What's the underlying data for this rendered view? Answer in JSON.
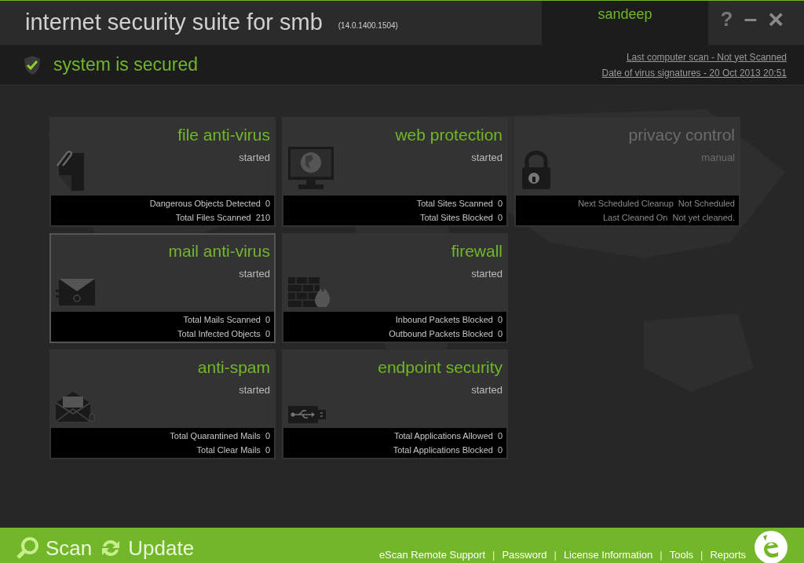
{
  "window": {
    "title": "internet security suite for smb",
    "version": "(14.0.1400.1504)",
    "user": "sandeep",
    "controls": [
      {
        "kind": "help",
        "label": "?"
      },
      {
        "kind": "minimize",
        "label": "–"
      },
      {
        "kind": "close",
        "label": "×"
      }
    ]
  },
  "status": {
    "secured": true,
    "text": "system is secured",
    "links": [
      "Last computer scan - Not yet Scanned",
      "Date of  virus signatures - 20 Oct 2013 20:51"
    ]
  },
  "tile_rows": [
    [
      {
        "kind": "file",
        "title": "file anti-virus",
        "state": "started",
        "enabled": true,
        "selected": false,
        "stats": [
          {
            "label": "Dangerous Objects Detected",
            "value": "0"
          },
          {
            "label": "Total Files Scanned",
            "value": "210"
          }
        ]
      },
      {
        "kind": "web",
        "title": "web protection",
        "state": "started",
        "enabled": true,
        "selected": false,
        "stats": [
          {
            "label": "Total Sites Scanned",
            "value": "0"
          },
          {
            "label": "Total Sites Blocked",
            "value": "0"
          }
        ]
      },
      {
        "kind": "privacy",
        "title": "privacy control",
        "state": "manual",
        "enabled": false,
        "selected": false,
        "stats": [
          {
            "label": "Next Scheduled Cleanup",
            "value": "Not Scheduled"
          },
          {
            "label": "Last Cleaned On",
            "value": "Not yet cleaned."
          }
        ]
      }
    ],
    [
      {
        "kind": "mail",
        "title": "mail anti-virus",
        "state": "started",
        "enabled": true,
        "selected": true,
        "stats": [
          {
            "label": "Total Mails Scanned",
            "value": "0"
          },
          {
            "label": "Total Infected Objects",
            "value": "0"
          }
        ]
      },
      {
        "kind": "firewall",
        "title": "firewall",
        "state": "started",
        "enabled": true,
        "selected": false,
        "stats": [
          {
            "label": "Inbound Packets Blocked",
            "value": "0"
          },
          {
            "label": "Outbound Packets Blocked",
            "value": "0"
          }
        ]
      }
    ],
    [
      {
        "kind": "spam",
        "title": "anti-spam",
        "state": "started",
        "enabled": true,
        "selected": false,
        "stats": [
          {
            "label": "Total Quarantined Mails",
            "value": "0"
          },
          {
            "label": "Total Clear Mails",
            "value": "0"
          }
        ]
      },
      {
        "kind": "endpoint",
        "title": "endpoint security",
        "state": "started",
        "enabled": true,
        "selected": false,
        "stats": [
          {
            "label": "Total Applications Allowed",
            "value": "0"
          },
          {
            "label": "Total Applications Blocked",
            "value": "0"
          }
        ]
      }
    ]
  ],
  "footer": {
    "actions": [
      {
        "kind": "scan",
        "label": "Scan"
      },
      {
        "kind": "update",
        "label": "Update"
      }
    ],
    "links": [
      {
        "kind": "link",
        "text": "eScan Remote Support"
      },
      {
        "kind": "separator",
        "text": "|"
      },
      {
        "kind": "link",
        "text": "Password"
      },
      {
        "kind": "separator",
        "text": "|"
      },
      {
        "kind": "link",
        "text": "License Information"
      },
      {
        "kind": "separator",
        "text": "|"
      },
      {
        "kind": "link",
        "text": "Tools"
      },
      {
        "kind": "separator",
        "text": "|"
      },
      {
        "kind": "link",
        "text": "Reports"
      }
    ]
  }
}
